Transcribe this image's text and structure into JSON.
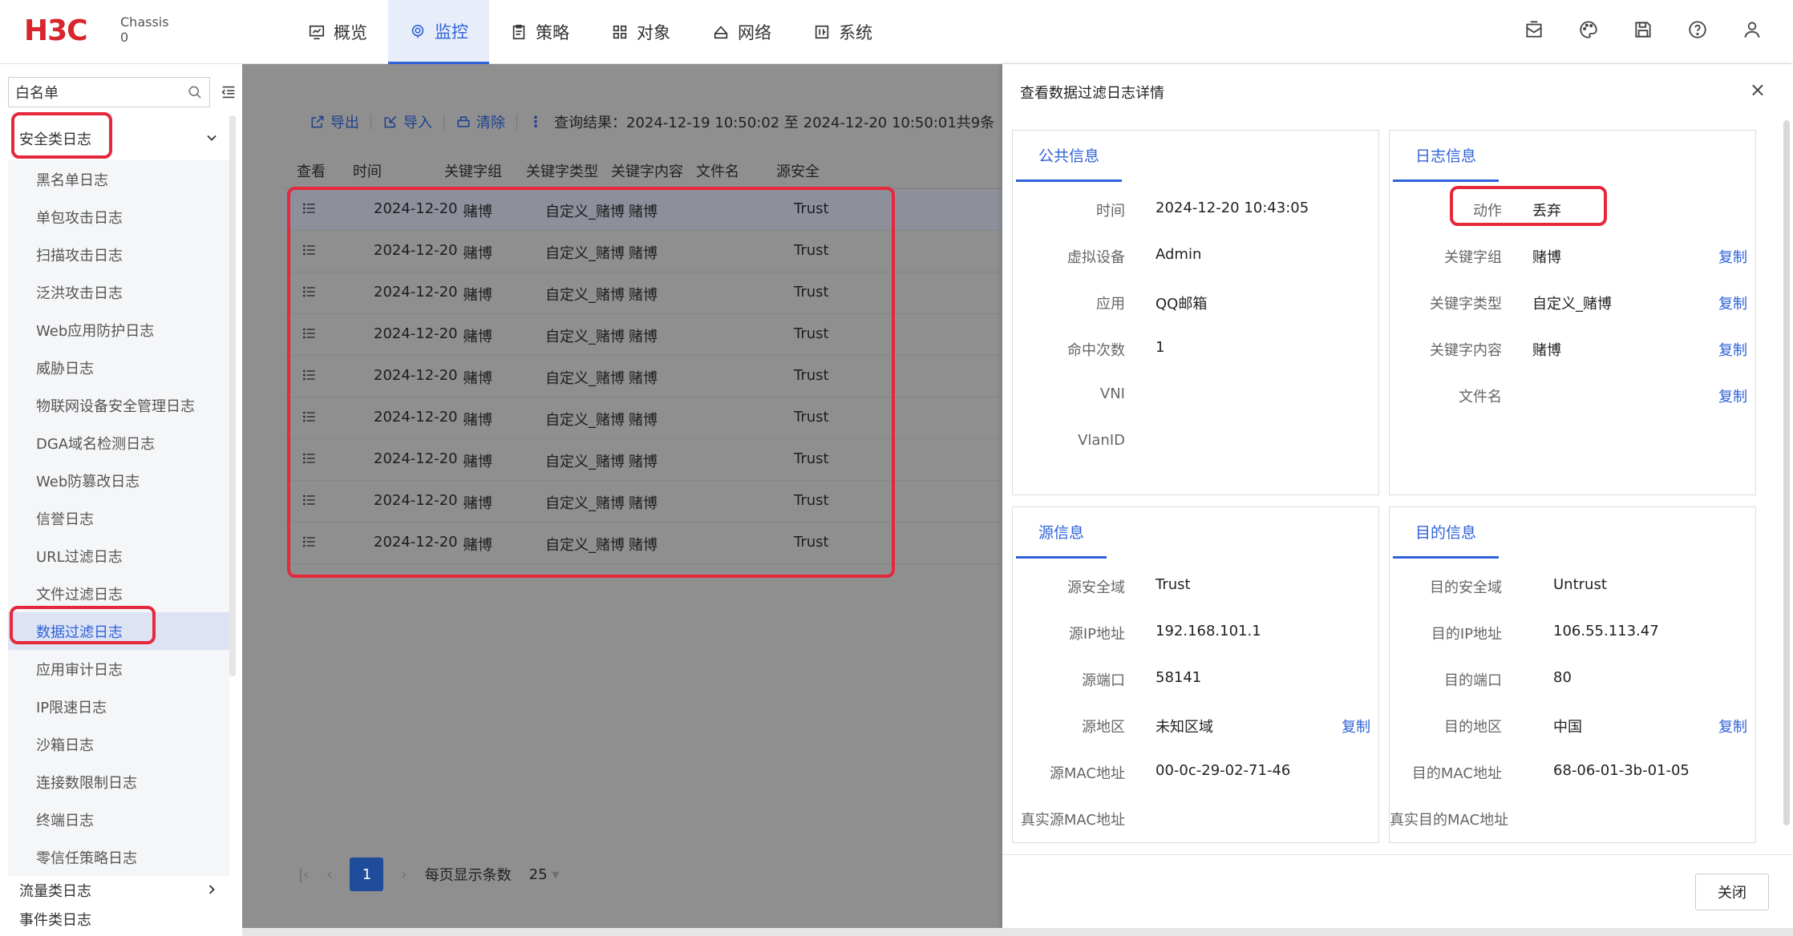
{
  "header": {
    "logo": "H3C",
    "chassis_label": "Chassis",
    "chassis_value": "0",
    "nav": [
      {
        "label": "概览",
        "icon": "dashboard-icon"
      },
      {
        "label": "监控",
        "icon": "monitor-icon",
        "active": true
      },
      {
        "label": "策略",
        "icon": "policy-icon"
      },
      {
        "label": "对象",
        "icon": "object-icon"
      },
      {
        "label": "网络",
        "icon": "network-icon"
      },
      {
        "label": "系统",
        "icon": "system-icon"
      }
    ]
  },
  "sidebar": {
    "search_value": "白名单",
    "group_security": "安全类日志",
    "items": [
      "黑名单日志",
      "单包攻击日志",
      "扫描攻击日志",
      "泛洪攻击日志",
      "Web应用防护日志",
      "威胁日志",
      "物联网设备安全管理日志",
      "DGA域名检测日志",
      "Web防篡改日志",
      "信誉日志",
      "URL过滤日志",
      "文件过滤日志",
      "数据过滤日志",
      "应用审计日志",
      "IP限速日志",
      "沙箱日志",
      "连接数限制日志",
      "终端日志",
      "零信任策略日志"
    ],
    "active_index": 12,
    "group_traffic": "流量类日志",
    "group_event": "事件类日志"
  },
  "toolbar": {
    "export": "导出",
    "import": "导入",
    "clear": "清除",
    "more": "⋮",
    "result": "查询结果：2024-12-19 10:50:02 至 2024-12-20 10:50:01共9条"
  },
  "table": {
    "headers": [
      "查看",
      "时间",
      "关键字组",
      "关键字类型",
      "关键字内容",
      "文件名",
      "源安全"
    ],
    "rows": [
      {
        "time": "2024-12-20 ...",
        "group": "赌博",
        "type": "自定义_赌博",
        "content": "赌博",
        "zone": "Trust"
      },
      {
        "time": "2024-12-20 ...",
        "group": "赌博",
        "type": "自定义_赌博",
        "content": "赌博",
        "zone": "Trust"
      },
      {
        "time": "2024-12-20 ...",
        "group": "赌博",
        "type": "自定义_赌博",
        "content": "赌博",
        "zone": "Trust"
      },
      {
        "time": "2024-12-20 ...",
        "group": "赌博",
        "type": "自定义_赌博",
        "content": "赌博",
        "zone": "Trust"
      },
      {
        "time": "2024-12-20 ...",
        "group": "赌博",
        "type": "自定义_赌博",
        "content": "赌博",
        "zone": "Trust"
      },
      {
        "time": "2024-12-20 ...",
        "group": "赌博",
        "type": "自定义_赌博",
        "content": "赌博",
        "zone": "Trust"
      },
      {
        "time": "2024-12-20 ...",
        "group": "赌博",
        "type": "自定义_赌博",
        "content": "赌博",
        "zone": "Trust"
      },
      {
        "time": "2024-12-20 ...",
        "group": "赌博",
        "type": "自定义_赌博",
        "content": "赌博",
        "zone": "Trust"
      },
      {
        "time": "2024-12-20 ...",
        "group": "赌博",
        "type": "自定义_赌博",
        "content": "赌博",
        "zone": "Trust"
      }
    ]
  },
  "pager": {
    "page": "1",
    "per_page_label": "每页显示条数",
    "per_page": "25"
  },
  "drawer": {
    "title": "查看数据过滤日志详情",
    "close_label": "关闭",
    "copy": "复制",
    "public": {
      "title": "公共信息",
      "fields": [
        {
          "k": "时间",
          "v": "2024-12-20 10:43:05"
        },
        {
          "k": "虚拟设备",
          "v": "Admin"
        },
        {
          "k": "应用",
          "v": "QQ邮箱"
        },
        {
          "k": "命中次数",
          "v": "1"
        },
        {
          "k": "VNI",
          "v": ""
        },
        {
          "k": "VlanID",
          "v": ""
        }
      ]
    },
    "log": {
      "title": "日志信息",
      "fields": [
        {
          "k": "动作",
          "v": "丢弃"
        },
        {
          "k": "关键字组",
          "v": "赌博"
        },
        {
          "k": "关键字类型",
          "v": "自定义_赌博"
        },
        {
          "k": "关键字内容",
          "v": "赌博"
        },
        {
          "k": "文件名",
          "v": ""
        }
      ]
    },
    "source": {
      "title": "源信息",
      "fields": [
        {
          "k": "源安全域",
          "v": "Trust"
        },
        {
          "k": "源IP地址",
          "v": "192.168.101.1"
        },
        {
          "k": "源端口",
          "v": "58141"
        },
        {
          "k": "源地区",
          "v": "未知区域"
        },
        {
          "k": "源MAC地址",
          "v": "00-0c-29-02-71-46"
        },
        {
          "k": "真实源MAC地址",
          "v": ""
        }
      ]
    },
    "dest": {
      "title": "目的信息",
      "fields": [
        {
          "k": "目的安全域",
          "v": "Untrust"
        },
        {
          "k": "目的IP地址",
          "v": "106.55.113.47"
        },
        {
          "k": "目的端口",
          "v": "80"
        },
        {
          "k": "目的地区",
          "v": "中国"
        },
        {
          "k": "目的MAC地址",
          "v": "68-06-01-3b-01-05"
        },
        {
          "k": "真实目的MAC地址",
          "v": ""
        }
      ]
    }
  },
  "colors": {
    "accent": "#2f62d8",
    "brand": "#d8262c",
    "highlight": "#e5283b",
    "overlay": "#8f8f8f"
  }
}
